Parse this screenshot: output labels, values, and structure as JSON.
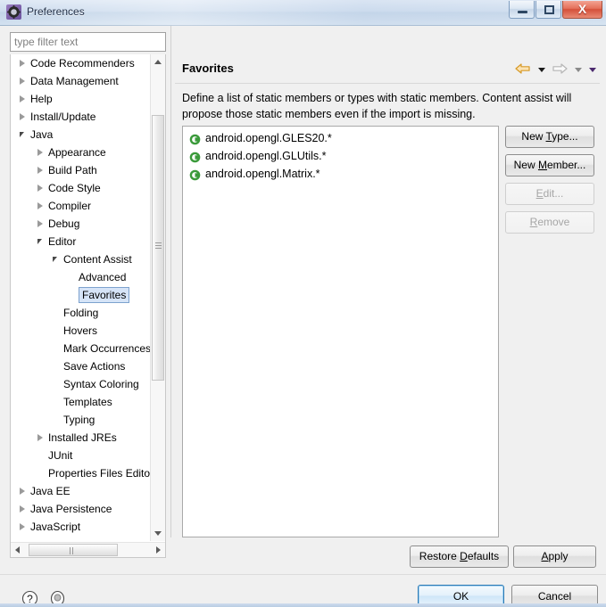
{
  "window": {
    "title": "Preferences",
    "icon": "gear-icon",
    "buttons": {
      "minimize": "minimize-icon",
      "maximize": "restore-icon",
      "close": "X"
    }
  },
  "sidebar": {
    "filter": {
      "placeholder": "type filter text",
      "value": ""
    },
    "tree": [
      {
        "label": "Code Recommenders",
        "depth": 0,
        "state": "collapsed",
        "selected": false
      },
      {
        "label": "Data Management",
        "depth": 0,
        "state": "collapsed",
        "selected": false
      },
      {
        "label": "Help",
        "depth": 0,
        "state": "collapsed",
        "selected": false
      },
      {
        "label": "Install/Update",
        "depth": 0,
        "state": "collapsed",
        "selected": false
      },
      {
        "label": "Java",
        "depth": 0,
        "state": "expanded",
        "selected": false
      },
      {
        "label": "Appearance",
        "depth": 1,
        "state": "collapsed",
        "selected": false
      },
      {
        "label": "Build Path",
        "depth": 1,
        "state": "collapsed",
        "selected": false
      },
      {
        "label": "Code Style",
        "depth": 1,
        "state": "collapsed",
        "selected": false
      },
      {
        "label": "Compiler",
        "depth": 1,
        "state": "collapsed",
        "selected": false
      },
      {
        "label": "Debug",
        "depth": 1,
        "state": "collapsed",
        "selected": false
      },
      {
        "label": "Editor",
        "depth": 1,
        "state": "expanded",
        "selected": false
      },
      {
        "label": "Content Assist",
        "depth": 2,
        "state": "expanded",
        "selected": false
      },
      {
        "label": "Advanced",
        "depth": 3,
        "state": "leaf",
        "selected": false
      },
      {
        "label": "Favorites",
        "depth": 3,
        "state": "leaf",
        "selected": true
      },
      {
        "label": "Folding",
        "depth": 2,
        "state": "leaf",
        "selected": false
      },
      {
        "label": "Hovers",
        "depth": 2,
        "state": "leaf",
        "selected": false
      },
      {
        "label": "Mark Occurrences",
        "depth": 2,
        "state": "leaf",
        "selected": false
      },
      {
        "label": "Save Actions",
        "depth": 2,
        "state": "leaf",
        "selected": false
      },
      {
        "label": "Syntax Coloring",
        "depth": 2,
        "state": "leaf",
        "selected": false
      },
      {
        "label": "Templates",
        "depth": 2,
        "state": "leaf",
        "selected": false
      },
      {
        "label": "Typing",
        "depth": 2,
        "state": "leaf",
        "selected": false
      },
      {
        "label": "Installed JREs",
        "depth": 1,
        "state": "collapsed",
        "selected": false
      },
      {
        "label": "JUnit",
        "depth": 1,
        "state": "leaf",
        "selected": false
      },
      {
        "label": "Properties Files Editor",
        "depth": 1,
        "state": "leaf",
        "selected": false
      },
      {
        "label": "Java EE",
        "depth": 0,
        "state": "collapsed",
        "selected": false
      },
      {
        "label": "Java Persistence",
        "depth": 0,
        "state": "collapsed",
        "selected": false
      },
      {
        "label": "JavaScript",
        "depth": 0,
        "state": "collapsed",
        "selected": false
      }
    ],
    "scrollbars": {
      "vertical": {
        "up_icon": "scroll-up-icon",
        "down_icon": "scroll-down-icon"
      },
      "horizontal": {
        "left_icon": "scroll-left-icon",
        "right_icon": "scroll-right-icon"
      }
    }
  },
  "page": {
    "title": "Favorites",
    "description": "Define a list of static members or types with static members. Content assist will propose those static members even if the import is missing.",
    "nav": {
      "back_icon": "back-arrow-icon",
      "back_menu_icon": "chevron-down-icon",
      "forward_icon": "forward-arrow-icon",
      "forward_menu_icon": "chevron-down-icon",
      "more_menu_icon": "chevron-down-icon"
    },
    "favorites": [
      {
        "icon": "java-class-icon",
        "label": "android.opengl.GLES20.*"
      },
      {
        "icon": "java-class-icon",
        "label": "android.opengl.GLUtils.*"
      },
      {
        "icon": "java-class-icon",
        "label": "android.opengl.Matrix.*"
      }
    ],
    "side_buttons": [
      {
        "label_pre": "New ",
        "mnemonic": "T",
        "label_post": "ype...",
        "enabled": true,
        "name": "new-type-button"
      },
      {
        "label_pre": "New ",
        "mnemonic": "M",
        "label_post": "ember...",
        "enabled": true,
        "name": "new-member-button"
      },
      {
        "label_pre": "",
        "mnemonic": "E",
        "label_post": "dit...",
        "enabled": false,
        "name": "edit-button"
      },
      {
        "label_pre": "",
        "mnemonic": "R",
        "label_post": "emove",
        "enabled": false,
        "name": "remove-button"
      }
    ],
    "restore_defaults": {
      "pre": "Restore ",
      "mnemonic": "D",
      "post": "efaults"
    },
    "apply": {
      "pre": "",
      "mnemonic": "A",
      "post": "pply"
    }
  },
  "footer": {
    "help_icon": "help-icon",
    "pin_icon": "pin-icon",
    "ok_label": "OK",
    "cancel_label": "Cancel"
  },
  "colors": {
    "selection": "#d6e4f7",
    "selection_border": "#7da2ce",
    "class_icon_green": "#3a9a3a",
    "back_arrow": "#e8a33d",
    "default_button_border": "#2b7ab5",
    "close_button": "#d4503a"
  }
}
